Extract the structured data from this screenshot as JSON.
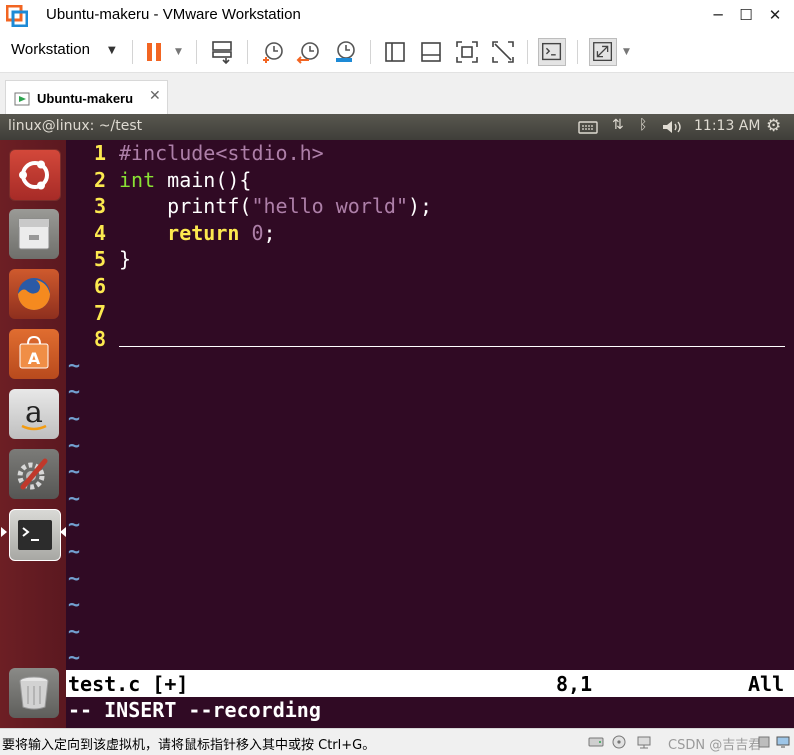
{
  "window": {
    "title": "Ubuntu-makeru - VMware Workstation",
    "minimize_glyph": "─",
    "maximize_glyph": "☐",
    "close_glyph": "✕"
  },
  "toolbar": {
    "menu_label": "Workstation",
    "icons": [
      "pause-icon",
      "send-ctrl-alt-del-icon",
      "snapshot-icon",
      "revert-snapshot-icon",
      "snapshot-manager-icon",
      "library-view-icon",
      "console-view-icon",
      "fullscreen-icon",
      "unity-icon",
      "terminal-view-icon",
      "stretch-icon"
    ]
  },
  "tab": {
    "label": "Ubuntu-makeru",
    "close_glyph": "✕"
  },
  "ubuntu_panel": {
    "window_title": "linux@linux: ~/test",
    "clock": "11:13 AM",
    "indicators": [
      "keyboard-icon",
      "network-icon",
      "bluetooth-icon",
      "volume-icon",
      "gear-icon"
    ]
  },
  "launcher": {
    "items": [
      "ubuntu-dash-icon",
      "files-icon",
      "firefox-icon",
      "software-center-icon",
      "amazon-icon",
      "system-settings-icon",
      "terminal-icon"
    ],
    "trash": "trash-icon"
  },
  "vim": {
    "lines": [
      {
        "num": "1",
        "parts": [
          {
            "t": "#include<stdio.h>",
            "c": "c-pre"
          }
        ]
      },
      {
        "num": "2",
        "parts": [
          {
            "t": "int",
            "c": "c-type"
          },
          {
            "t": " main(){",
            "c": "c-punct"
          }
        ]
      },
      {
        "num": "3",
        "parts": [
          {
            "t": "    printf(",
            "c": "c-punct"
          },
          {
            "t": "\"hello world\"",
            "c": "c-str"
          },
          {
            "t": ");",
            "c": "c-punct"
          }
        ]
      },
      {
        "num": "4",
        "parts": [
          {
            "t": "    ",
            "c": "c-punct"
          },
          {
            "t": "return",
            "c": "c-kw"
          },
          {
            "t": " ",
            "c": "c-punct"
          },
          {
            "t": "0",
            "c": "c-num"
          },
          {
            "t": ";",
            "c": "c-punct"
          }
        ]
      },
      {
        "num": "5",
        "parts": [
          {
            "t": "}",
            "c": "c-punct"
          }
        ]
      },
      {
        "num": "6",
        "parts": []
      },
      {
        "num": "7",
        "parts": []
      },
      {
        "num": "8",
        "parts": []
      }
    ],
    "tilde": "~",
    "tilde_count": 12,
    "status_file": "test.c [+]",
    "status_pos": "8,1",
    "status_scroll": "All",
    "mode": "-- INSERT --recording"
  },
  "bottom": {
    "hint": "要将输入定向到该虚拟机，请将鼠标指针移入其中或按 Ctrl+G。",
    "watermark": "CSDN @吉吉君"
  },
  "colors": {
    "terminal_bg": "#300a24",
    "line_number": "#fce94f",
    "launcher_bg": "#6d1f24",
    "vmware_orange": "#f26522"
  }
}
